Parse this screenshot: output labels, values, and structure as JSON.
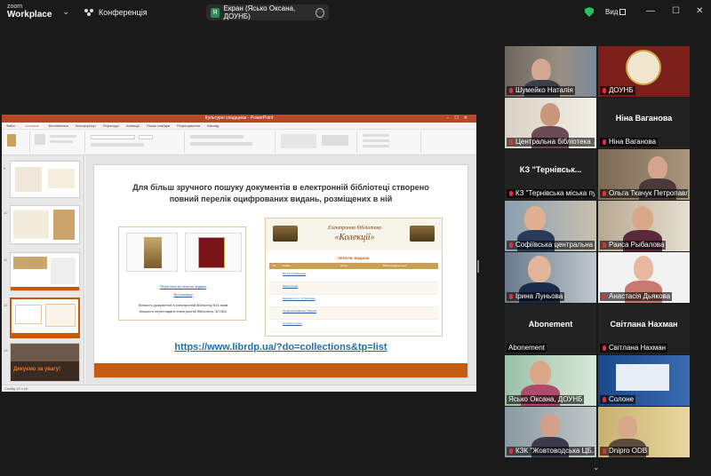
{
  "app": {
    "logo_line1": "zoom",
    "logo_line2": "Workplace",
    "meeting_label": "Конференція",
    "share_initial": "Я",
    "share_title": "Екран (Ясько Оксана, ДОУНБ)",
    "view_label": "Вид",
    "more_symbol": "···",
    "minimize": "—",
    "maximize": "☐",
    "close": "✕",
    "scroll_down": "⌄"
  },
  "presentation": {
    "window_title": "Культурні спадщини - PowerPoint",
    "tabs": [
      "Файл",
      "Основне",
      "Вставлення",
      "Конструктор",
      "Переходи",
      "Анімації",
      "Показ слайдів",
      "Рецензування",
      "Вигляд"
    ],
    "active_tab": "Основне",
    "slide_numbers": [
      "9",
      "10",
      "11",
      "12",
      "13"
    ],
    "status_text": "Слайд 12 з 16",
    "thumb5_text": "Дякуємо за увагу!",
    "slide": {
      "title": "Для більш зручного пошуку документів в електронній бібліотеці створено повний перелік оцифрованих видань, розміщених в ній",
      "link1": "Переглянути перелік видань",
      "link2": "Всі колекції",
      "text1": "Кількість документів в електронній бібліотеці 816 назв",
      "text2": "Кількість переглядів в електронній бібліотеці: 327824",
      "collection_title_line1": "Електронна бібліотека",
      "collection_title_line2": "«Колекції»",
      "collection_subtitle": "ПЕРЕЛІК ВИДАНЬ",
      "table_headers": [
        "№",
        "Назва",
        "Автор",
        "Бібліографічні дані"
      ],
      "table_rows": [
        "Вік Річок Київщини",
        "Землеописи",
        "Записки лит. т. 4 Гребцова",
        "Катеринославська губернія",
        "Історичні описи"
      ],
      "url": "https://www.librdp.ua/?do=collections&tp=list"
    }
  },
  "participants": [
    {
      "name": "Шумейко Наталія",
      "muted": true,
      "type": "video"
    },
    {
      "name": "ДОУНБ",
      "muted": true,
      "type": "logo"
    },
    {
      "name": "Центральна бібліотека ...",
      "muted": true,
      "type": "video"
    },
    {
      "name": "Ніна Ваганова",
      "muted": true,
      "type": "name",
      "big": "Ніна Ваганова"
    },
    {
      "name": "КЗ \"Тернівська міська пу...",
      "muted": true,
      "type": "name",
      "big": "КЗ \"Тернівськ..."
    },
    {
      "name": "Ольга Ткачук Петропавл...",
      "muted": true,
      "type": "video"
    },
    {
      "name": "Софіївська центральна ...",
      "muted": true,
      "type": "video"
    },
    {
      "name": "Раиса Рыбалова",
      "muted": true,
      "type": "video"
    },
    {
      "name": "Ірина Луньова",
      "muted": true,
      "type": "video"
    },
    {
      "name": "Анастасія Дьякова",
      "muted": true,
      "type": "video"
    },
    {
      "name": "Abonement",
      "muted": false,
      "type": "name",
      "big": "Abonement"
    },
    {
      "name": "Світлана Нахман",
      "muted": true,
      "type": "name",
      "big": "Світлана Нахман"
    },
    {
      "name": "Ясько Оксана, ДОУНБ",
      "muted": false,
      "type": "video",
      "active": true
    },
    {
      "name": "Солоне",
      "muted": true,
      "type": "video"
    },
    {
      "name": "КЗК \"Жовтоводська ЦБ...",
      "muted": true,
      "type": "video"
    },
    {
      "name": "Dnipro ODB",
      "muted": true,
      "type": "video"
    }
  ]
}
